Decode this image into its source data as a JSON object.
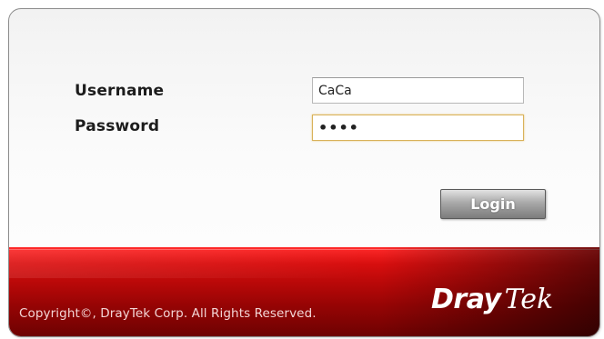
{
  "login": {
    "username_label": "Username",
    "password_label": "Password",
    "username_value": "CaCa",
    "password_value": "••••",
    "login_button": "Login"
  },
  "footer": {
    "copyright": "Copyright©, DrayTek Corp. All Rights Reserved.",
    "brand_dray": "Dray",
    "brand_tek": "Tek"
  },
  "colors": {
    "footer_red": "#c80b0b",
    "input_focus_border": "#d9b25a",
    "button_gray": "#9a9a9a"
  }
}
